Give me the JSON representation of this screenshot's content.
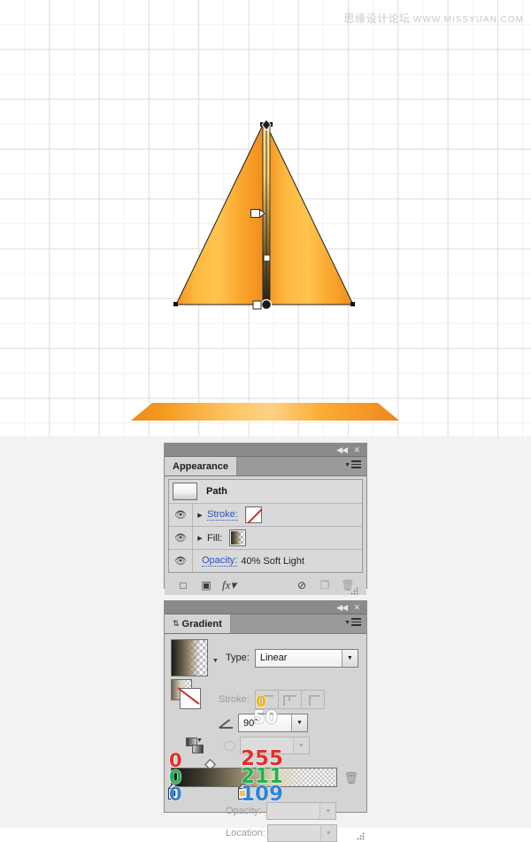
{
  "watermark": {
    "chinese": "思缘设计论坛",
    "url": "WWW.MISSYUAN.COM"
  },
  "canvas": {
    "name": "artboard-canvas",
    "grid": "on",
    "artwork": {
      "triangle": {
        "fill_top": "#FFC04A",
        "fill_bottom": "#F28C1E",
        "stroke": "#1a1a1a"
      },
      "base_shape": {
        "fill_left": "#F08B1D",
        "fill_mid": "#FDBE5A",
        "fill_right": "#EE8A1C"
      },
      "gradient_annotation": {
        "angle": "90",
        "top_color": "#FFD36D",
        "bottom_color": "#2b2414"
      }
    }
  },
  "appearance_panel": {
    "title": "Appearance",
    "tab_label": "Appearance",
    "collapse_label": "◀◀",
    "close_label": "✕",
    "object_name": "Path",
    "rows": [
      {
        "label": "Stroke:",
        "swatch": "none",
        "eye": "visible",
        "disclosure": "collapsed"
      },
      {
        "label": "Fill:",
        "swatch": "gradient",
        "eye": "visible",
        "disclosure": "collapsed"
      }
    ],
    "opacity_label": "Opacity:",
    "opacity_value": "40% Soft Light",
    "footer": {
      "add_stroke": "add-new-stroke",
      "add_fill": "add-new-fill",
      "fx": "fx",
      "clear": "clear-appearance",
      "duplicate": "duplicate-item",
      "delete": "delete-item"
    }
  },
  "gradient_panel": {
    "tab_label": "Gradient",
    "tab_icon": "⇅",
    "collapse_label": "◀◀",
    "close_label": "✕",
    "type_label": "Type:",
    "type_value": "Linear",
    "stroke_label": "Stroke:",
    "angle_value": "90°",
    "opacity_label": "Opacity:",
    "location_label": "Location:",
    "overlays": {
      "left_r": "0",
      "left_g": "0",
      "left_b": "0",
      "right_r": "255",
      "right_g": "211",
      "right_b": "109",
      "aspect": "0",
      "location_mid": "50"
    },
    "stops": [
      {
        "position": 0,
        "color": "#000000",
        "label": "0"
      },
      {
        "position": 42,
        "color": "#FFD36D",
        "label": "255"
      }
    ]
  }
}
